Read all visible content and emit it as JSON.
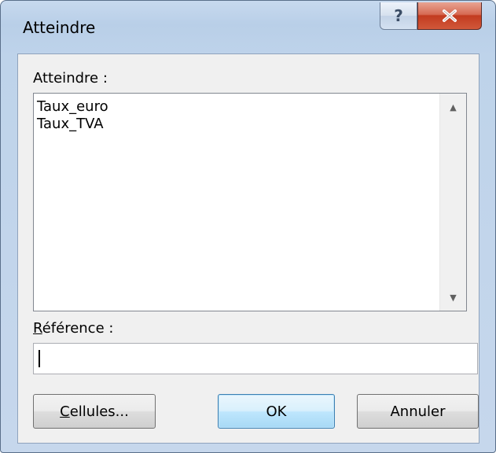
{
  "window": {
    "title": "Atteindre",
    "help_symbol": "?",
    "close_symbol": "X"
  },
  "goto_list": {
    "label": "Atteindre :",
    "items": [
      "Taux_euro",
      "Taux_TVA"
    ]
  },
  "reference": {
    "label_mnemonic": "R",
    "label_rest": "éférence :",
    "value": ""
  },
  "buttons": {
    "special_mnemonic": "C",
    "special_rest": "ellules...",
    "ok": "OK",
    "cancel": "Annuler"
  }
}
